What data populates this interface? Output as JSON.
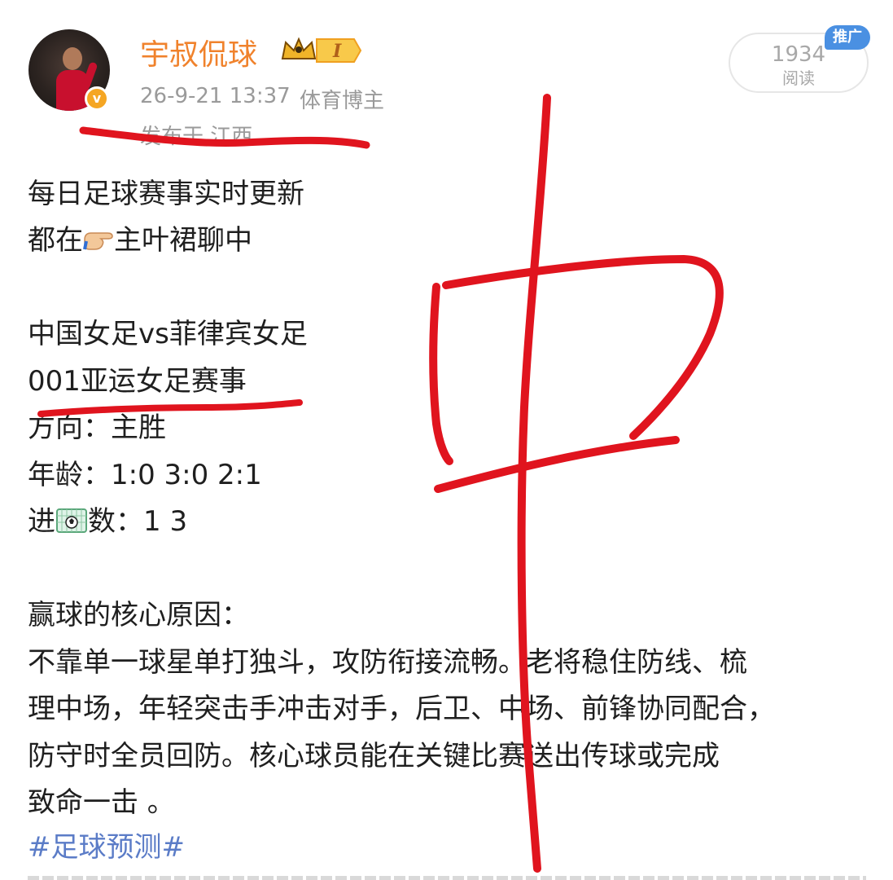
{
  "post": {
    "author": {
      "name": "宇叔侃球",
      "level_badge": "I",
      "avatar": "avatar",
      "verified_icon": "verified-v-icon"
    },
    "meta": {
      "time": "26-9-21 13:37",
      "role": "体育博主",
      "location": "发布于 江西"
    },
    "stats": {
      "read_count": "1934",
      "read_label": "阅读",
      "promo_tag": "推广"
    },
    "lines": [
      "每日足球赛事实时更新",
      "主叶裙聊中",
      "中国女足vs菲律宾女足",
      "001亚运女足赛事",
      "方向：主胜",
      "年龄：1:0 3:0 2:1",
      "数：1 3",
      "赢球的核心原因：",
      "不靠单一球星单打独斗，攻防衔接流畅。老将稳住防线、梳",
      "理中场，年轻突击手冲击对手，后卫、中场、前锋协同配合，",
      "防守时全员回防。核心球员能在关键比赛送出传球或完成",
      "致命一击 。"
    ],
    "line2_prefix": "都在",
    "line7_prefix": "进",
    "hashtag": "#足球预测#",
    "icons": {
      "pointing_hand": "pointing-hand-icon",
      "goal_net": "goal-net-icon",
      "crown": "crown-icon"
    }
  },
  "annotations": {
    "handwritten_character": "中",
    "marker_color": "#e0141e"
  }
}
